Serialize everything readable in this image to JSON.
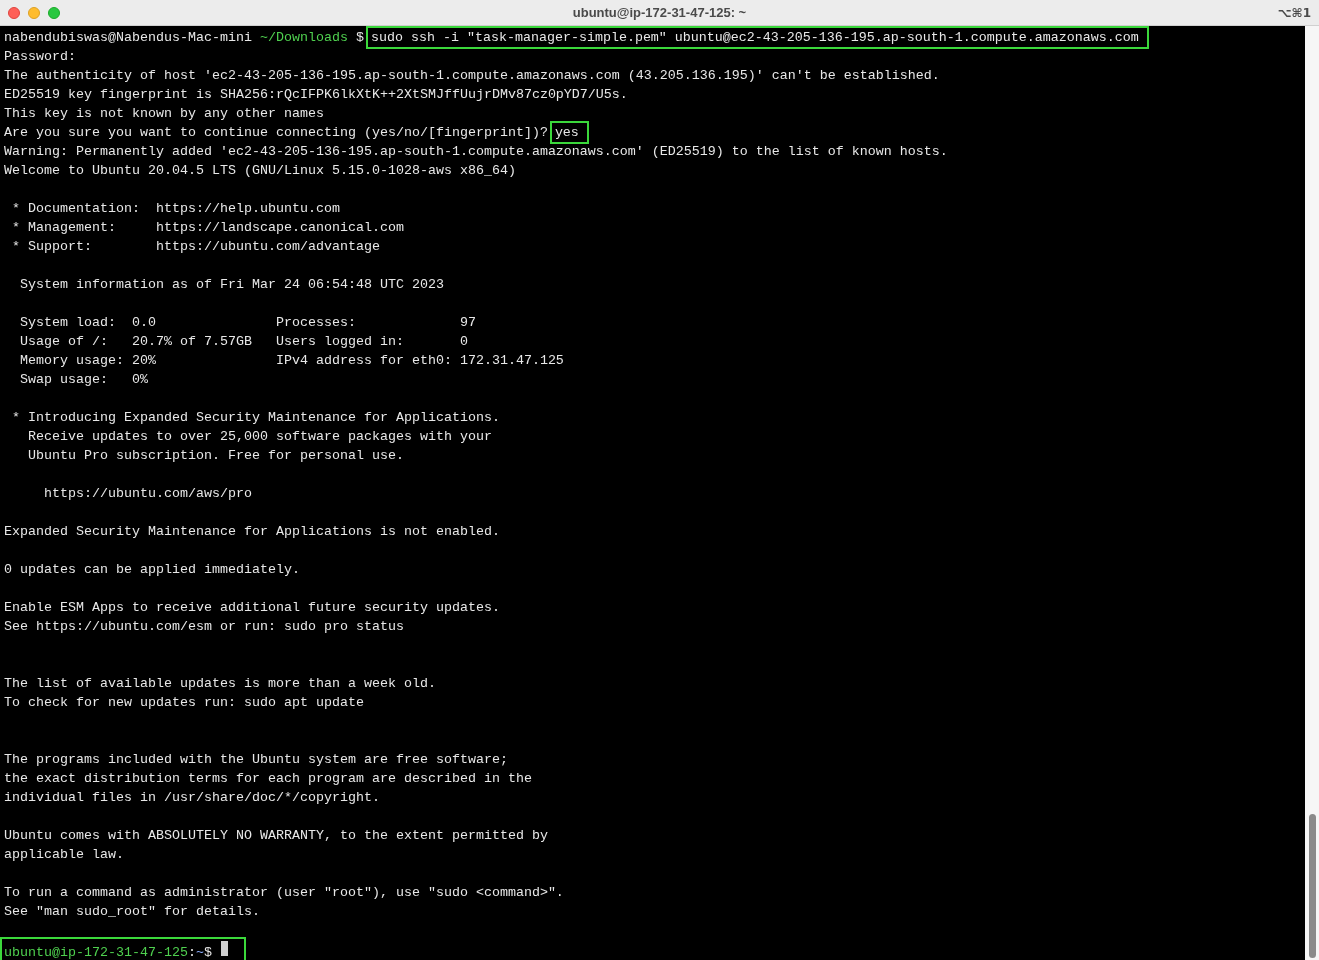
{
  "window": {
    "title": "ubuntu@ip-172-31-47-125: ~",
    "shortcut": "⌥⌘1"
  },
  "lines": [
    {
      "kind": "mixed",
      "parts": [
        {
          "kind": "plain",
          "text": "nabendubiswas@Nabendus-Mac-mini "
        },
        {
          "kind": "path",
          "text": "~/Downloads"
        },
        {
          "kind": "plain",
          "text": " $ "
        },
        {
          "kind": "highlight",
          "text": "sudo ssh -i \"task-manager-simple.pem\" ubuntu@ec2-43-205-136-195.ap-south-1.compute.amazonaws.com"
        }
      ]
    },
    {
      "kind": "text",
      "text": "Password:"
    },
    {
      "kind": "text",
      "text": "The authenticity of host 'ec2-43-205-136-195.ap-south-1.compute.amazonaws.com (43.205.136.195)' can't be established."
    },
    {
      "kind": "text",
      "text": "ED25519 key fingerprint is SHA256:rQcIFPK6lkXtK++2XtSMJffUujrDMv87cz0pYD7/U5s."
    },
    {
      "kind": "text",
      "text": "This key is not known by any other names"
    },
    {
      "kind": "mixed",
      "parts": [
        {
          "kind": "plain",
          "text": "Are you sure you want to continue connecting (yes/no/[fingerprint])? "
        },
        {
          "kind": "highlight",
          "text": "yes"
        }
      ]
    },
    {
      "kind": "text",
      "text": "Warning: Permanently added 'ec2-43-205-136-195.ap-south-1.compute.amazonaws.com' (ED25519) to the list of known hosts."
    },
    {
      "kind": "text",
      "text": "Welcome to Ubuntu 20.04.5 LTS (GNU/Linux 5.15.0-1028-aws x86_64)"
    },
    {
      "kind": "blank"
    },
    {
      "kind": "text",
      "text": " * Documentation:  https://help.ubuntu.com"
    },
    {
      "kind": "text",
      "text": " * Management:     https://landscape.canonical.com"
    },
    {
      "kind": "text",
      "text": " * Support:        https://ubuntu.com/advantage"
    },
    {
      "kind": "blank"
    },
    {
      "kind": "text",
      "text": "  System information as of Fri Mar 24 06:54:48 UTC 2023"
    },
    {
      "kind": "blank"
    },
    {
      "kind": "text",
      "text": "  System load:  0.0               Processes:             97"
    },
    {
      "kind": "text",
      "text": "  Usage of /:   20.7% of 7.57GB   Users logged in:       0"
    },
    {
      "kind": "text",
      "text": "  Memory usage: 20%               IPv4 address for eth0: 172.31.47.125"
    },
    {
      "kind": "text",
      "text": "  Swap usage:   0%"
    },
    {
      "kind": "blank"
    },
    {
      "kind": "text",
      "text": " * Introducing Expanded Security Maintenance for Applications."
    },
    {
      "kind": "text",
      "text": "   Receive updates to over 25,000 software packages with your"
    },
    {
      "kind": "text",
      "text": "   Ubuntu Pro subscription. Free for personal use."
    },
    {
      "kind": "blank"
    },
    {
      "kind": "text",
      "text": "     https://ubuntu.com/aws/pro"
    },
    {
      "kind": "blank"
    },
    {
      "kind": "text",
      "text": "Expanded Security Maintenance for Applications is not enabled."
    },
    {
      "kind": "blank"
    },
    {
      "kind": "text",
      "text": "0 updates can be applied immediately."
    },
    {
      "kind": "blank"
    },
    {
      "kind": "text",
      "text": "Enable ESM Apps to receive additional future security updates."
    },
    {
      "kind": "text",
      "text": "See https://ubuntu.com/esm or run: sudo pro status"
    },
    {
      "kind": "blank"
    },
    {
      "kind": "blank"
    },
    {
      "kind": "text",
      "text": "The list of available updates is more than a week old."
    },
    {
      "kind": "text",
      "text": "To check for new updates run: sudo apt update"
    },
    {
      "kind": "blank"
    },
    {
      "kind": "blank"
    },
    {
      "kind": "text",
      "text": "The programs included with the Ubuntu system are free software;"
    },
    {
      "kind": "text",
      "text": "the exact distribution terms for each program are described in the"
    },
    {
      "kind": "text",
      "text": "individual files in /usr/share/doc/*/copyright."
    },
    {
      "kind": "blank"
    },
    {
      "kind": "text",
      "text": "Ubuntu comes with ABSOLUTELY NO WARRANTY, to the extent permitted by"
    },
    {
      "kind": "text",
      "text": "applicable law."
    },
    {
      "kind": "blank"
    },
    {
      "kind": "text",
      "text": "To run a command as administrator (user \"root\"), use \"sudo <command>\"."
    },
    {
      "kind": "text",
      "text": "See \"man sudo_root\" for details."
    },
    {
      "kind": "blank"
    },
    {
      "kind": "boxed",
      "parts": [
        {
          "kind": "user",
          "text": "ubuntu@ip-172-31-47-125"
        },
        {
          "kind": "plain",
          "text": ":"
        },
        {
          "kind": "tilde",
          "text": "~"
        },
        {
          "kind": "plain",
          "text": "$ "
        }
      ]
    }
  ]
}
